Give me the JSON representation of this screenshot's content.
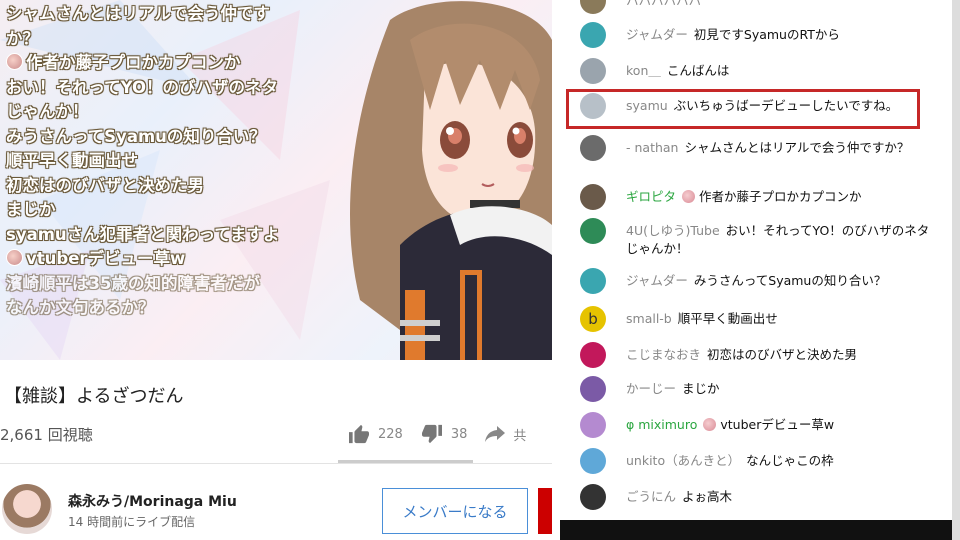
{
  "video": {
    "overlay_comments": [
      {
        "text": "シャムさんとはリアルで会う仲です",
        "icon": false
      },
      {
        "text": "か？",
        "icon": false
      },
      {
        "text": "作者か藤子プロかカプコンか",
        "icon": true
      },
      {
        "text": "おい！それってYO！のびハザのネタ",
        "icon": false
      },
      {
        "text": "じゃんか！",
        "icon": false
      },
      {
        "text": "みうさんってSyamuの知り合い？",
        "icon": false
      },
      {
        "text": "順平早く動画出せ",
        "icon": false
      },
      {
        "text": "初恋はのびバザと決めた男",
        "icon": false
      },
      {
        "text": "まじか",
        "icon": false
      },
      {
        "text": "syamuさん犯罪者と関わってますよ",
        "icon": false
      },
      {
        "text": "vtuberデビュー草w",
        "icon": true
      },
      {
        "text": "濱崎順平は35歳の知的障害者だが",
        "icon": false
      },
      {
        "text": "なんか文句あるか？",
        "icon": false
      }
    ]
  },
  "info": {
    "title": "【雑談】よるざつだん",
    "views": "2,661 回視聴",
    "likes": "228",
    "dislikes": "38",
    "share": "共",
    "channel_name": "森永みう/Morinaga Miu",
    "live_time": "14 時間前にライブ配信",
    "member_button": "メンバーになる"
  },
  "chat": {
    "messages": [
      {
        "author": "ハハハハハハ",
        "text": "",
        "avatar_color": "#8a7a5a",
        "name_style": "normal",
        "badge": false
      },
      {
        "author": "ジャムダー",
        "text": "初見ですSyamuのRTから",
        "avatar_color": "#3aa6b0",
        "name_style": "normal",
        "badge": false
      },
      {
        "author": "kon＿",
        "text": "こんばんは",
        "avatar_color": "#9aa4ad",
        "name_style": "normal",
        "badge": false
      },
      {
        "author": "syamu",
        "text": "ぶいちゅうばーデビューしたいですね。",
        "avatar_color": "#b7c0c8",
        "name_style": "normal",
        "badge": false
      },
      {
        "author": "- nathan",
        "text": "シャムさんとはリアルで会う仲ですか？",
        "avatar_color": "#6b6b6b",
        "name_style": "normal",
        "badge": false
      },
      {
        "author": "ギロピタ",
        "text": "作者か藤子プロかカプコンか",
        "avatar_color": "#6a5a4a",
        "name_style": "green",
        "badge": true
      },
      {
        "author": "4U(しゆう)Tube",
        "text": "おい！それってYO！のびハザのネタじゃんか！",
        "avatar_color": "#2e8b57",
        "name_style": "normal",
        "badge": false
      },
      {
        "author": "ジャムダー",
        "text": "みうさんってSyamuの知り合い？",
        "avatar_color": "#3aa6b0",
        "name_style": "normal",
        "badge": false
      },
      {
        "author": "small-b",
        "text": "順平早く動画出せ",
        "avatar_color": "#e6c300",
        "name_style": "normal",
        "badge": false,
        "letter": "b"
      },
      {
        "author": "こじまなおき",
        "text": "初恋はのびバザと決めた男",
        "avatar_color": "#c2185b",
        "name_style": "normal",
        "badge": false
      },
      {
        "author": "かーじー",
        "text": "まじか",
        "avatar_color": "#7b5aa6",
        "name_style": "normal",
        "badge": false
      },
      {
        "author": "φ miximuro",
        "text": "vtuberデビュー草w",
        "avatar_color": "#b48ad0",
        "name_style": "green",
        "badge": true
      },
      {
        "author": "unkito（あんきと）",
        "text": "なんじゃこの枠",
        "avatar_color": "#5fa8d8",
        "name_style": "normal",
        "badge": false
      },
      {
        "author": "ごうにん",
        "text": "よぉ高木",
        "avatar_color": "#333333",
        "name_style": "normal",
        "badge": false
      }
    ]
  }
}
